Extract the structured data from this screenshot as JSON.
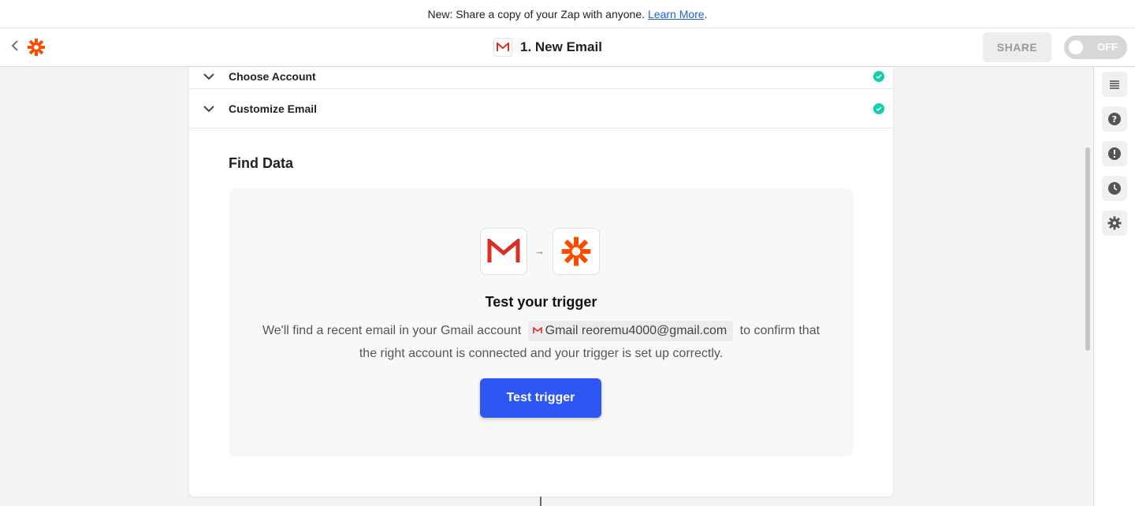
{
  "banner": {
    "text": "New: Share a copy of your Zap with anyone.",
    "link": "Learn More",
    "suffix": "."
  },
  "topbar": {
    "back_icon": "chevron-left-icon",
    "logo_icon": "zapier-asterisk-icon",
    "title_icon": "gmail-icon",
    "title": "1. New Email",
    "share_label": "SHARE",
    "toggle_label": "OFF"
  },
  "accordion": [
    {
      "label": "Choose Account",
      "status": "complete"
    },
    {
      "label": "Customize Email",
      "status": "complete"
    }
  ],
  "find_data": {
    "title": "Find Data",
    "card": {
      "from_icon": "gmail-icon",
      "to_icon": "zapier-icon",
      "heading": "Test your trigger",
      "desc_before": "We'll find a recent email in your Gmail account",
      "account_pill": "Gmail reoremu4000@gmail.com",
      "desc_after": "to confirm that the right account is connected and your trigger is set up correctly.",
      "button_label": "Test trigger"
    }
  },
  "rail": [
    {
      "name": "list-icon"
    },
    {
      "name": "help-icon"
    },
    {
      "name": "alert-icon"
    },
    {
      "name": "clock-icon"
    },
    {
      "name": "gear-icon"
    }
  ],
  "colors": {
    "accent": "#2d56f2",
    "success": "#13d0ab",
    "zapier_orange": "#ff4a00",
    "gmail_red": "#d93025"
  }
}
